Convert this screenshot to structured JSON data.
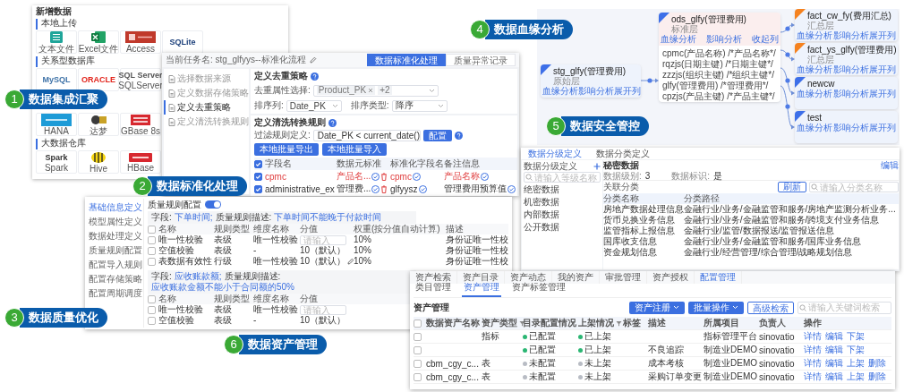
{
  "labels": [
    {
      "number": "1",
      "text": "数据集成汇聚"
    },
    {
      "number": "2",
      "text": "数据标准化处理"
    },
    {
      "number": "3",
      "text": "数据质量优化"
    },
    {
      "number": "4",
      "text": "数据血缘分析"
    },
    {
      "number": "5",
      "text": "数据安全管控"
    },
    {
      "number": "6",
      "text": "数据资产管理"
    }
  ],
  "integration": {
    "title": "新增数据",
    "sections": [
      {
        "name": "本地上传",
        "rows": [
          [
            {
              "kind": "csv",
              "caption": "文本文件"
            },
            {
              "kind": "excel",
              "caption": "Excel文件"
            },
            {
              "kind": "access",
              "caption": "Access"
            },
            {
              "kind": "text",
              "logo_text": "SQLite",
              "color": "#1b3f7a"
            }
          ]
        ]
      },
      {
        "name": "关系型数据库",
        "rows": [
          [
            {
              "kind": "text",
              "logo_text": "MySQL",
              "color": "#3f73a8"
            },
            {
              "kind": "text",
              "logo_text": "ORACLE",
              "color": "#e2231a"
            },
            {
              "kind": "text",
              "logo_text": "SQL Server",
              "color": "#555555",
              "caption": "SQLServer"
            }
          ],
          [
            {
              "kind": "hana",
              "caption": "HANA"
            },
            {
              "kind": "dameng",
              "caption": "达梦"
            },
            {
              "kind": "gbase",
              "caption": "GBase 8s"
            }
          ]
        ]
      },
      {
        "name": "大数据仓库",
        "rows": [
          [
            {
              "kind": "text",
              "logo_text": "Spark",
              "color": "#333333",
              "caption": "Spark"
            },
            {
              "kind": "hive",
              "caption": "Hive"
            },
            {
              "kind": "hbase",
              "caption": "HBase"
            }
          ]
        ]
      }
    ]
  },
  "standardize": {
    "task": "当前任务名: stg_glfyys--标准化流程",
    "tabs": [
      {
        "label": "数据标准化处理",
        "selected": true
      },
      {
        "label": "质量异常记录",
        "selected": false
      }
    ],
    "steps": [
      {
        "label": "选择数据来源",
        "selected": false
      },
      {
        "label": "定义数据存储策略",
        "selected": false
      },
      {
        "label": "定义去重策略",
        "selected": true
      },
      {
        "label": "定义清洗转换规则",
        "selected": false
      }
    ],
    "dedup": {
      "title": "定义去重策略",
      "fields": [
        {
          "label": "去重属性选择:",
          "kind": "tags",
          "tags": [
            {
              "text": "Product_PK",
              "removable": true
            },
            {
              "text": "+2",
              "removable": false
            }
          ]
        },
        {
          "label": "排序列:",
          "kind": "select",
          "value": "Date_PK"
        },
        {
          "label": "排序类型:",
          "kind": "select",
          "value": "降序"
        }
      ]
    },
    "clean": {
      "title": "定义清洗转换规则",
      "filter_label": "过滤规则定义:",
      "filter_value": "Date_PK < current_date()",
      "button": "配置"
    },
    "actions": [
      "本地批量导出",
      "本地批量导入"
    ],
    "table": {
      "all_checked": true,
      "columns": [
        "字段名",
        "数据元标准",
        "标准化字段名",
        "备注信息"
      ],
      "rows": [
        {
          "checked": true,
          "flagged": true,
          "cells": [
            "cpmc",
            "产品名...",
            "cpmc",
            "产品名称"
          ]
        },
        {
          "checked": true,
          "flagged": false,
          "cells": [
            "administrative_ex",
            "管理费...",
            "glfyysz",
            "管理费用预算值"
          ]
        }
      ]
    }
  },
  "lineage": {
    "source": {
      "name": "stg_glfy(管理费用)",
      "layer": "原始层",
      "color": "#3d6fe8",
      "links": [
        "血缘分析",
        "影响分析",
        "展开列"
      ]
    },
    "middle": {
      "name": "ods_glfy(管理费用)",
      "layer": "标准层",
      "color": "#3d6fe8",
      "links": [
        "血缘分析",
        "影响分析",
        "收起列"
      ],
      "columns": [
        "cpmc(产品名称) /*产品名称*/",
        "rqzjs(日期主键) /*日期主键*/",
        "zzzjs(组织主键) /*组织主键*/",
        "glfy(管理费用) /*管理费用*/",
        "cpzjs(产品主键) /*产品主键*/"
      ]
    },
    "targets": [
      {
        "name": "fact_cw_fy(费用汇总)",
        "layer": "汇总层",
        "color": "#f5821f",
        "links": [
          "血缘分析",
          "影响分析",
          "展开列"
        ]
      },
      {
        "name": "fact_ys_glfy(管理费用)",
        "layer": "汇总层",
        "color": "#f5821f",
        "links": [
          "血缘分析",
          "影响分析",
          "展开列"
        ]
      },
      {
        "name": "newcw",
        "color": "#3d6fe8",
        "links": [
          "血缘分析",
          "影响分析",
          "展开列"
        ]
      },
      {
        "name": "test",
        "color": "#3d6fe8",
        "links": [
          "血缘分析",
          "影响分析",
          "展开列"
        ]
      }
    ]
  },
  "quality": {
    "menu": [
      {
        "label": "基础信息定义",
        "selected": true
      },
      {
        "label": "模型属性定义",
        "selected": false
      },
      {
        "label": "数据处理定义",
        "selected": false
      },
      {
        "label": "质量规则配置",
        "selected": false
      },
      {
        "label": "配置导入规则",
        "selected": false
      },
      {
        "label": "配置存储策略",
        "selected": false
      },
      {
        "label": "配置周期调度",
        "selected": false
      }
    ],
    "toggle": {
      "label": "质量规则配置",
      "on": true
    },
    "groups": [
      {
        "field_label": "字段:",
        "field": "下单时间;",
        "rule_label": "质量规则描述:",
        "rule": "下单时间不能晚于付款时间",
        "all_checked": false,
        "columns": [
          "名称",
          "规则类型",
          "维度名称",
          "分值",
          "权重(按分值自动计算)",
          "描述"
        ],
        "rows": [
          {
            "checked": false,
            "name": "唯一性校验",
            "type": "表级",
            "dimension": "唯一性校验",
            "score": {
              "kind": "input",
              "placeholder": "请输入"
            },
            "weight": "10%",
            "description": "身份证唯一性校"
          },
          {
            "checked": false,
            "name": "空值校验",
            "type": "表级",
            "dimension": "-",
            "score": {
              "kind": "text",
              "text": "10（默认）",
              "editable": false
            },
            "weight": "10%",
            "description": "身份证唯一性校"
          },
          {
            "checked": false,
            "name": "表数据有效性",
            "type": "行级",
            "dimension": "唯一性校验",
            "score": {
              "kind": "text",
              "text": "10（默认）",
              "editable": true
            },
            "weight": "10%",
            "description": "身份证唯一性校"
          }
        ]
      },
      {
        "field_label": "字段:",
        "field": "应收账款额;",
        "rule_label": "质量规则描述:",
        "rule": "应收账款金额不能小于合同额的50%",
        "all_checked": false,
        "columns": [
          "名称",
          "规则类型",
          "维度名称",
          "分值"
        ],
        "rows": [
          {
            "checked": false,
            "name": "唯一性校验",
            "type": "表级",
            "dimension": "唯一性校验",
            "score": {
              "kind": "input",
              "placeholder": "请输入"
            }
          },
          {
            "checked": false,
            "name": "空值校验",
            "type": "表级",
            "dimension": "-",
            "score": {
              "kind": "text",
              "text": "10（默认）",
              "editable": false
            }
          }
        ]
      }
    ]
  },
  "security": {
    "tabs": [
      {
        "label": "数据分级定义",
        "selected": true
      },
      {
        "label": "数据分类定义",
        "selected": false
      }
    ],
    "sidebar": {
      "title": "数据分级定义",
      "search_placeholder": "请输入等级名称",
      "items": [
        {
          "name": "绝密数据",
          "selected": false
        },
        {
          "name": "机密数据",
          "selected": false
        },
        {
          "name": "内部数据",
          "selected": false
        },
        {
          "name": "公开数据",
          "selected": false
        }
      ]
    },
    "detail": {
      "title": "秘密数据",
      "edit": "编辑",
      "grade_label": "数据级别:",
      "grade": "3",
      "flag_label": "数据标识:",
      "flag": "是"
    },
    "related": {
      "title": "关联分类",
      "button": "刷新",
      "search_placeholder": "请输入分类名称",
      "columns": [
        "分类名称",
        "分类路径"
      ],
      "rows": [
        [
          "房地产数据处理信息",
          "金融行业/业务/金融监管和服务/房地产监测分析业务..."
        ],
        [
          "货币兑换业务信息",
          "金融行业/业务/金融监管和服务/跨境支付业务信息"
        ],
        [
          "监管指标上报信息",
          "金融行业/监管/数据报送/监管报送信息"
        ],
        [
          "国库收支信息",
          "金融行业/业务/金融监管和服务/国库业务信息"
        ],
        [
          "资金规划信息",
          "金融行业/经营管理/综合管理/战略规划信息"
        ]
      ]
    }
  },
  "assets": {
    "nav": [
      {
        "label": "资产检索",
        "selected": false
      },
      {
        "label": "资产目录",
        "selected": false
      },
      {
        "label": "资产动态",
        "selected": false
      },
      {
        "label": "我的资产",
        "selected": false
      },
      {
        "label": "审批管理",
        "selected": false
      },
      {
        "label": "资产授权",
        "selected": false
      },
      {
        "label": "配置管理",
        "selected": true
      }
    ],
    "subtabs": [
      {
        "label": "类目管理",
        "selected": false
      },
      {
        "label": "资产管理",
        "selected": true
      },
      {
        "label": "资产标签管理",
        "selected": false
      }
    ],
    "title": "资产管理",
    "all_checked": false,
    "buttons": [
      {
        "label": "资产注册",
        "kind": "dropdown"
      },
      {
        "label": "批量操作",
        "kind": "dropdown"
      },
      {
        "label": "高级检索",
        "kind": "outline"
      }
    ],
    "search_placeholder": "请输入关键词检索",
    "columns": [
      {
        "label": "数据资产名称",
        "filter": false
      },
      {
        "label": "资产类型",
        "filter": true
      },
      {
        "label": "目录配置情况",
        "filter": false
      },
      {
        "label": "上架情况",
        "filter": true
      },
      {
        "label": "标签",
        "filter": false
      },
      {
        "label": "描述",
        "filter": false
      },
      {
        "label": "所属项目",
        "filter": false
      },
      {
        "label": "负责人",
        "filter": false
      },
      {
        "label": "操作",
        "filter": false
      }
    ],
    "rows": [
      {
        "checked": false,
        "type": "指标",
        "catalog": {
          "text": "已配置",
          "ok": true
        },
        "listing": {
          "text": "已上架",
          "ok": true
        },
        "project": "指标管理平台",
        "owner": "sinovatio",
        "actions": [
          "详情",
          "编辑",
          "下架"
        ]
      },
      {
        "checked": false,
        "catalog": {
          "text": "已配置",
          "ok": true
        },
        "listing": {
          "text": "已上架",
          "ok": true
        },
        "description": "不良追踪",
        "project": "制造业DEMO",
        "owner": "sinovatio",
        "actions": [
          "详情",
          "编辑",
          "下架"
        ]
      },
      {
        "checked": false,
        "name": "cbm_cgy_c...",
        "type": "表",
        "catalog": {
          "text": "未配置",
          "ok": false
        },
        "listing": {
          "text": "未上架",
          "ok": false
        },
        "description": "成本考核",
        "project": "制造业DEMO",
        "owner": "sinovatio",
        "actions": [
          "详情",
          "编辑",
          "上架",
          "删除"
        ]
      },
      {
        "checked": false,
        "name": "cbm_cgy_c...",
        "type": "表",
        "catalog": {
          "text": "未配置",
          "ok": false
        },
        "listing": {
          "text": "未上架",
          "ok": false
        },
        "description": "采购订单变更",
        "project": "制造业DEMO",
        "owner": "sinovatio",
        "actions": [
          "详情",
          "编辑",
          "上架",
          "删除"
        ]
      }
    ]
  }
}
